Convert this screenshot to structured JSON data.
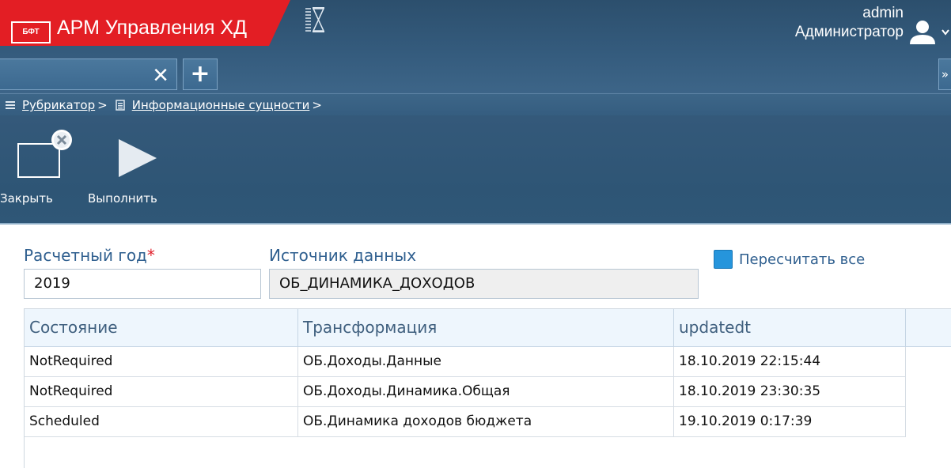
{
  "app": {
    "logo_text": "БФТ",
    "title": "АРМ Управления ХД"
  },
  "user": {
    "name": "admin",
    "role": "Администратор"
  },
  "tabs": {
    "active_tab_label": "",
    "close_glyph": "×",
    "add_glyph": "+",
    "overflow_glyph": "»"
  },
  "breadcrumb": {
    "items": [
      "Рубрикатор",
      "Информационные сущности"
    ],
    "separator": ">"
  },
  "toolbar": {
    "close_label": "Закрыть",
    "run_label": "Выполнить"
  },
  "form": {
    "year_label": "Расчетный год",
    "required_mark": "*",
    "year_value": "2019",
    "source_label": "Источник данных",
    "source_value": "ОБ_ДИНАМИКА_ДОХОДОВ",
    "recalc_label": "Пересчитать все",
    "recalc_checked": true
  },
  "grid": {
    "columns": [
      "Состояние",
      "Трансформация",
      "updatedt"
    ],
    "rows": [
      [
        "NotRequired",
        "ОБ.Доходы.Данные",
        "18.10.2019 22:15:44"
      ],
      [
        "NotRequired",
        "ОБ.Доходы.Динамика.Общая",
        "18.10.2019 23:30:35"
      ],
      [
        "Scheduled",
        "ОБ.Динамика доходов бюджета",
        "19.10.2019 0:17:39"
      ]
    ]
  },
  "colors": {
    "brand_red": "#e31e24",
    "header_blue": "#355c7e",
    "accent_blue": "#2695dc",
    "label_blue": "#2f5f8f",
    "required_red": "#e01f2a"
  }
}
